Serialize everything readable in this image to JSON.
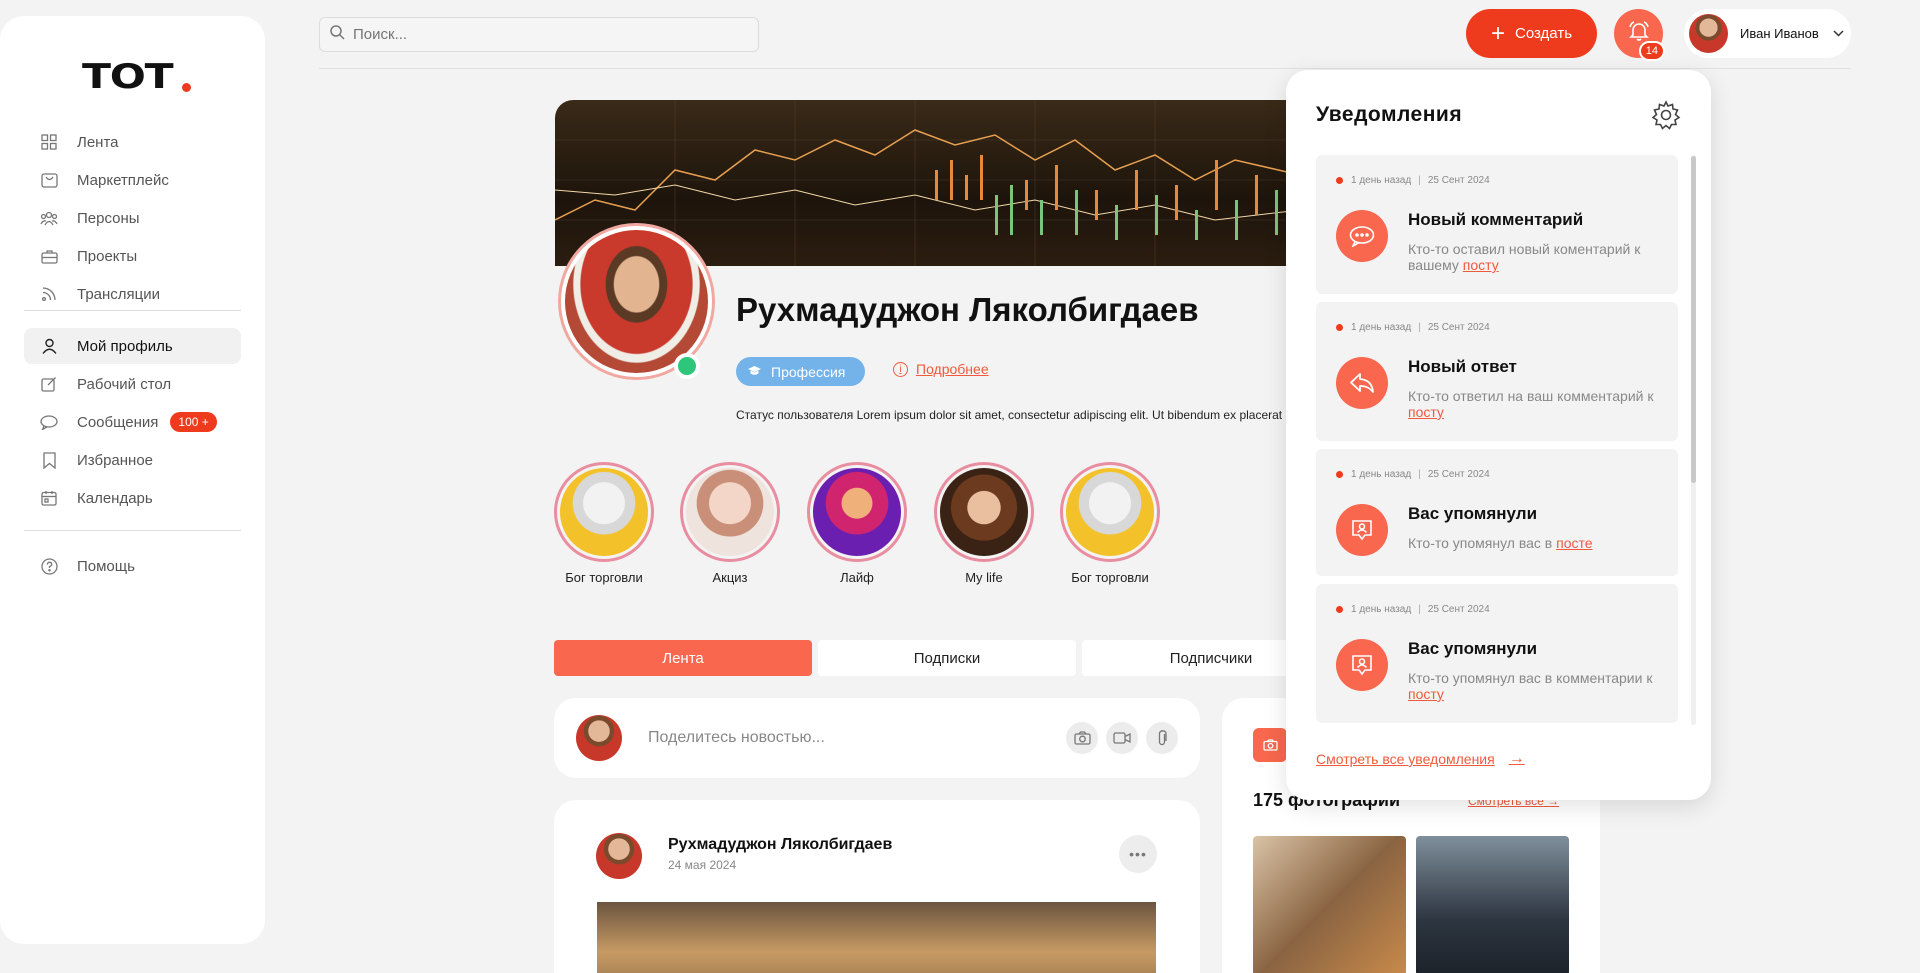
{
  "logo": {
    "text": "ТОТ"
  },
  "sidebar": {
    "items": [
      {
        "label": "Лента",
        "icon": "grid-icon"
      },
      {
        "label": "Маркетплейс",
        "icon": "shopping-bag-icon"
      },
      {
        "label": "Персоны",
        "icon": "people-icon"
      },
      {
        "label": "Проекты",
        "icon": "briefcase-icon"
      },
      {
        "label": "Трансляции",
        "icon": "broadcast-icon"
      }
    ],
    "items2": [
      {
        "label": "Мой профиль",
        "icon": "user-icon",
        "active": true
      },
      {
        "label": "Рабочий стол",
        "icon": "edit-icon"
      },
      {
        "label": "Сообщения",
        "icon": "chat-icon",
        "badge": "100 +"
      },
      {
        "label": "Избранное",
        "icon": "bookmark-icon"
      },
      {
        "label": "Календарь",
        "icon": "calendar-icon"
      }
    ],
    "items3": [
      {
        "label": "Помощь",
        "icon": "help-icon"
      }
    ]
  },
  "search": {
    "placeholder": "Поиск..."
  },
  "header": {
    "create_label": "Создать",
    "notif_count": "14",
    "user_name": "Иван Иванов"
  },
  "profile": {
    "name": "Рухмадуджон Ляколбигдаев",
    "profession": "Профессия",
    "more": "Подробнее",
    "status": "Статус пользователя Lorem ipsum dolor sit amet, consectetur adipiscing elit. Ut bibendum ex placerat"
  },
  "stories": [
    {
      "label": "Бог торговли"
    },
    {
      "label": "Акциз"
    },
    {
      "label": "Лайф"
    },
    {
      "label": "My life"
    },
    {
      "label": "Бог торговли"
    }
  ],
  "tabs": [
    {
      "label": "Лента",
      "active": true
    },
    {
      "label": "Подписки"
    },
    {
      "label": "Подписчики"
    }
  ],
  "share": {
    "placeholder": "Поделитесь новостью..."
  },
  "post": {
    "author": "Рухмадуджон Ляколбигдаев",
    "date": "24 мая 2024"
  },
  "photos": {
    "title": "175 фотографий",
    "see_all": "Смотреть все"
  },
  "notifications": {
    "title": "Уведомления",
    "view_all": "Смотреть все уведомления",
    "items": [
      {
        "ago": "1 день назад",
        "date": "25 Сент 2024",
        "title": "Новый комментарий",
        "text": "Кто-то оставил новый коментарий к вашему ",
        "link": "посту",
        "icon": "comment-icon"
      },
      {
        "ago": "1 день назад",
        "date": "25 Сент 2024",
        "title": "Новый ответ",
        "text": "Кто-то ответил на ваш комментарий к ",
        "link": "посту",
        "icon": "reply-icon"
      },
      {
        "ago": "1 день назад",
        "date": "25 Сент 2024",
        "title": "Вас упомянули",
        "text": "Кто-то упомянул вас в ",
        "link": "посте",
        "icon": "mention-icon"
      },
      {
        "ago": "1 день назад",
        "date": "25 Сент 2024",
        "title": "Вас упомянули",
        "text": "Кто-то упомянул вас в комментарии к ",
        "link": "посту",
        "icon": "mention-icon"
      }
    ]
  },
  "colors": {
    "accent": "#ef3b1d",
    "accent_soft": "#f8674e",
    "profession": "#74b3ea",
    "online": "#2ec67a"
  }
}
